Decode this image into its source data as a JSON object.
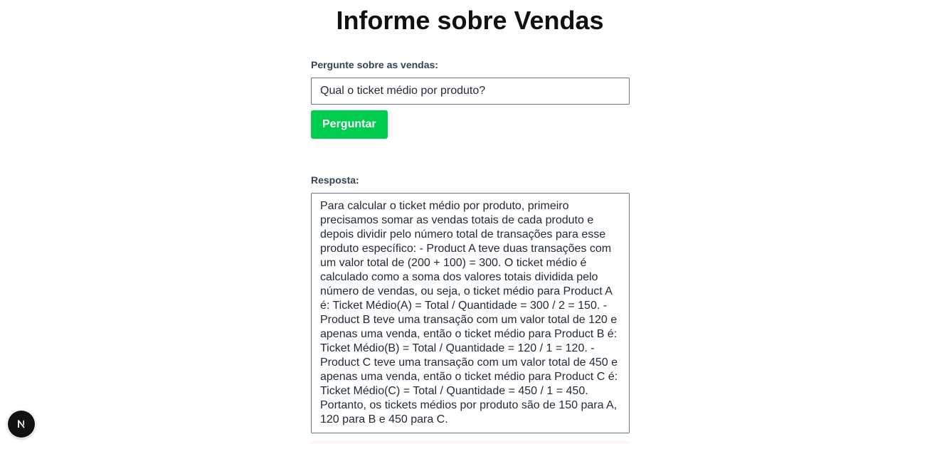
{
  "page": {
    "title": "Informe sobre Vendas"
  },
  "question": {
    "label": "Pergunte sobre as vendas:",
    "value": "Qual o ticket médio por produto?"
  },
  "ask_button": {
    "label": "Perguntar"
  },
  "answer": {
    "label": "Resposta:",
    "text": "Para calcular o ticket médio por produto, primeiro precisamos somar as vendas totais de cada produto e depois dividir pelo número total de transações para esse produto específico: - Product A teve duas transações com um valor total de (200 + 100) = 300. O ticket médio é calculado como a soma dos valores totais dividida pelo número de vendas, ou seja, o ticket médio para Product A é: Ticket Médio(A) = Total / Quantidade = 300 / 2 = 150. - Product B teve uma transação com um valor total de 120 e apenas uma venda, então o ticket médio para Product B é: Ticket Médio(B) = Total / Quantidade = 120 / 1 = 120. - Product C teve uma transação com um valor total de 450 e apenas uma venda, então o ticket médio para Product C é: Ticket Médio(C) = Total / Quantidade = 450 / 1 = 450. Portanto, os tickets médios por produto são de 150 para A, 120 para B e 450 para C."
  },
  "dev_indicator": {
    "icon": "nextjs-logo-icon",
    "letter": "N"
  },
  "colors": {
    "button_bg": "#00cc4d",
    "button_text": "#ffffff",
    "border": "#6b7280",
    "title": "#111111"
  }
}
